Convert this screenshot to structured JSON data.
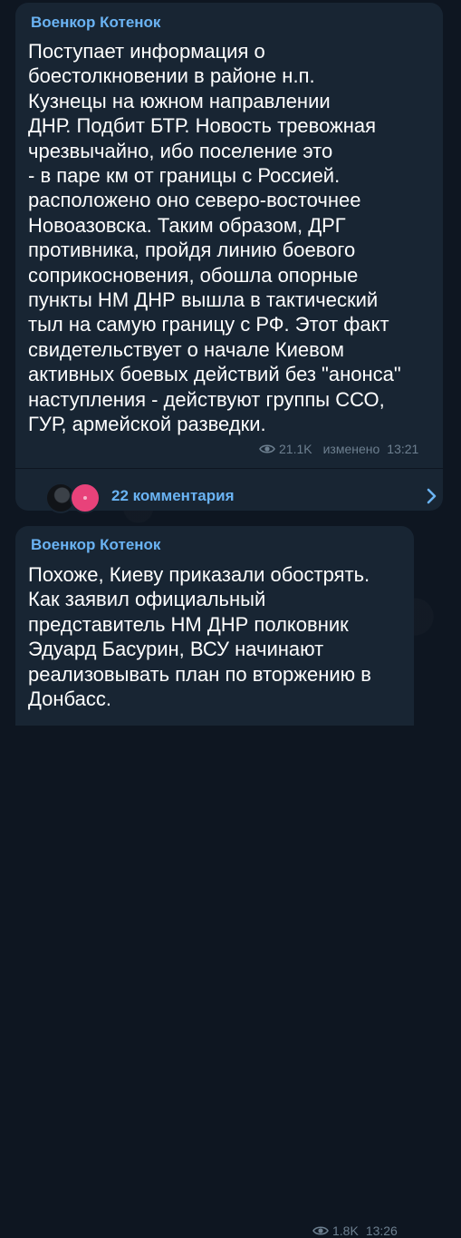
{
  "messages": [
    {
      "sender": "Военкор Котенок",
      "text": "Поступает информация о\nбоестолкновении в районе н.п.\nКузнецы на южном направлении\nДНР. Подбит БТР. Новость тревожная\nчрезвычайно, ибо поселение это\n- в паре км от границы с Россией.\nрасположено оно северо-восточнее\nНовоазовска. Таким образом, ДРГ\nпротивника, пройдя линию боевого\nсоприкосновения, обошла опорные\nпункты НМ ДНР вышла в тактический\nтыл на самую границу с РФ. Этот факт\nсвидетельствует о начале Киевом\nактивных боевых действий без \"анонса\"\nнаступления - действуют группы ССО,\nГУР, армейской разведки.",
      "views": "21.1K",
      "edited": "изменено",
      "time": "13:21",
      "comments_label": "22 комментария",
      "icons": {
        "views": "eye-icon",
        "open_comments": "chevron-right-icon"
      }
    },
    {
      "sender": "Военкор Котенок",
      "text": "Похоже, Киеву приказали обострять.\nКак заявил официальный\nпредставитель НМ ДНР полковник\nЭдуард Басурин, ВСУ начинают\nреализовывать план по вторжению в\nДонбасс.",
      "views": "1.8K",
      "time": "13:26",
      "icons": {
        "views": "eye-icon"
      }
    }
  ],
  "colors": {
    "background": "#0e1621",
    "bubble": "#182533",
    "accent": "#6ab3f3",
    "meta": "#6d7f8f",
    "text": "#ffffff",
    "avatar_pink": "#e8427a"
  }
}
